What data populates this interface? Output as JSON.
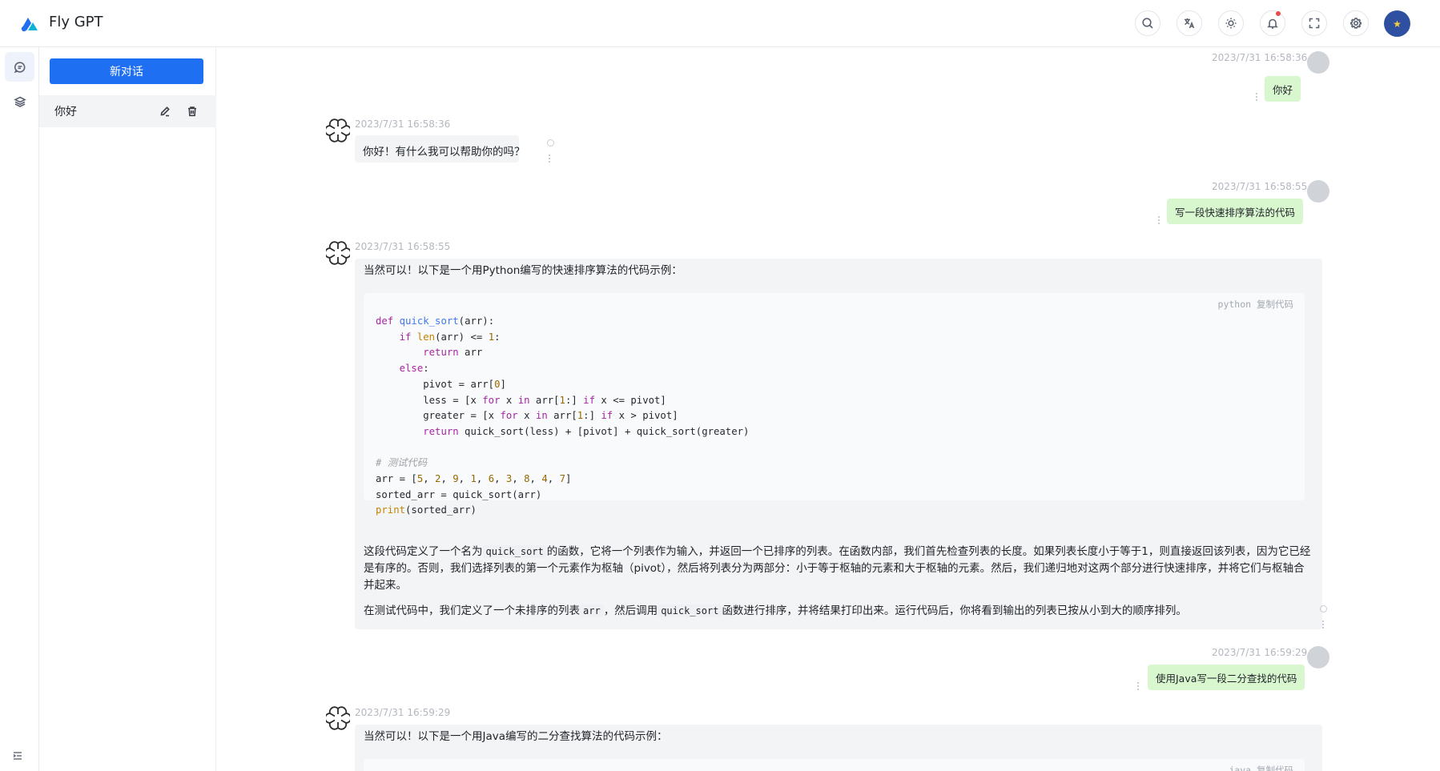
{
  "app": {
    "title": "Fly GPT"
  },
  "sidebar": {
    "new_chat_label": "新对话",
    "conversations": [
      {
        "label": "你好"
      }
    ]
  },
  "messages": [
    {
      "role": "user",
      "time": "2023/7/31 16:58:36",
      "text": "你好"
    },
    {
      "role": "assistant",
      "time": "2023/7/31 16:58:36",
      "text": "你好！有什么我可以帮助你的吗？"
    },
    {
      "role": "user",
      "time": "2023/7/31 16:58:55",
      "text": "写一段快速排序算法的代码"
    },
    {
      "role": "assistant",
      "time": "2023/7/31 16:58:55",
      "intro": "当然可以！以下是一个用Python编写的快速排序算法的代码示例：",
      "code_lang": "python",
      "copy_label": "复制代码",
      "p1_a": "这段代码定义了一个名为",
      "p1_code": "quick_sort",
      "p1_b": "的函数，它将一个列表作为输入，并返回一个已排序的列表。在函数内部，我们首先检查列表的长度。如果列表长度小于等于1，则直接返回该列表，因为它已经是有序的。否则，我们选择列表的第一个元素作为枢轴（pivot），然后将列表分为两部分：小于等于枢轴的元素和大于枢轴的元素。然后，我们递归地对这两个部分进行快速排序，并将它们与枢轴合并起来。",
      "p2_a": "在测试代码中，我们定义了一个未排序的列表",
      "p2_code1": "arr",
      "p2_b": "，然后调用",
      "p2_code2": "quick_sort",
      "p2_c": "函数进行排序，并将结果打印出来。运行代码后，你将看到输出的列表已按从小到大的顺序排列。"
    },
    {
      "role": "user",
      "time": "2023/7/31 16:59:29",
      "text": "使用Java写一段二分查找的代码"
    },
    {
      "role": "assistant",
      "time": "2023/7/31 16:59:29",
      "intro": "当然可以！以下是一个用Java编写的二分查找算法的代码示例：",
      "code_lang": "java",
      "copy_label": "复制代码"
    }
  ],
  "icons": [
    "logo-icon",
    "search-icon",
    "translate-icon",
    "theme-icon",
    "bell-icon",
    "fullscreen-icon",
    "gear-icon",
    "chat-icon",
    "layers-icon",
    "edit-icon",
    "trash-icon",
    "fold-icon"
  ]
}
